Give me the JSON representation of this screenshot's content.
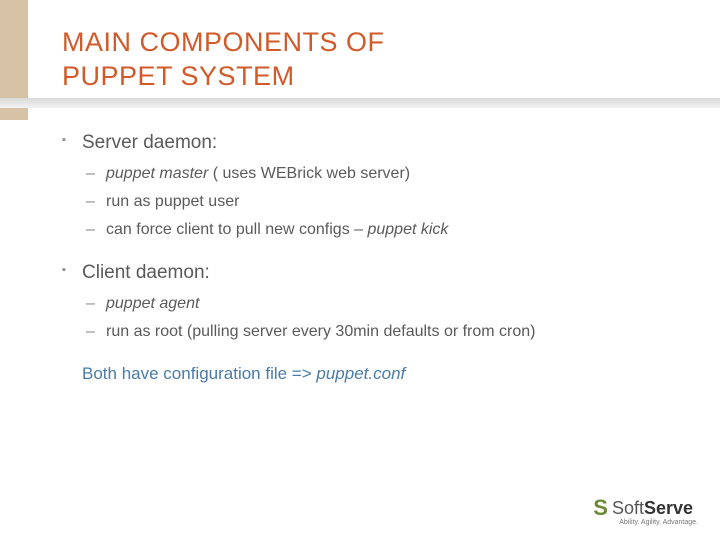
{
  "title_line1": "MAIN COMPONENTS OF",
  "title_line2": "PUPPET SYSTEM",
  "sections": [
    {
      "heading": "Server daemon:",
      "items": [
        {
          "pre_em": "",
          "em": "puppet master",
          "post_em": " ( uses WEBrick web server)"
        },
        {
          "pre_em": "run as puppet user",
          "em": "",
          "post_em": ""
        },
        {
          "pre_em": "can force client to pull new configs – ",
          "em": "puppet kick",
          "post_em": ""
        }
      ]
    },
    {
      "heading": "Client daemon:",
      "items": [
        {
          "pre_em": "",
          "em": "puppet agent",
          "post_em": ""
        },
        {
          "pre_em": "run as root (pulling server every 30min defaults or from cron)",
          "em": "",
          "post_em": ""
        }
      ]
    }
  ],
  "footer_note_pre": "Both have configuration file => ",
  "footer_note_em": "puppet.conf",
  "logo": {
    "soft": "Soft",
    "serve": "Serve",
    "tagline": "Ability. Agility. Advantage."
  }
}
